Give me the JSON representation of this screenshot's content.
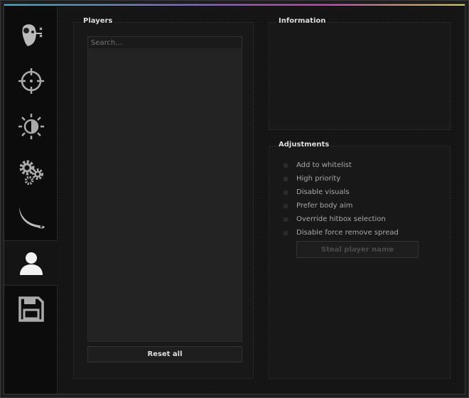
{
  "tabs": [
    {
      "icon": "ragebot-head-icon"
    },
    {
      "icon": "crosshair-icon"
    },
    {
      "icon": "visuals-brightness-icon"
    },
    {
      "icon": "gears-icon"
    },
    {
      "icon": "knife-icon"
    },
    {
      "icon": "user-icon",
      "active": true
    },
    {
      "icon": "save-floppy-icon"
    }
  ],
  "players": {
    "title": "Players",
    "search_placeholder": "Search...",
    "search_value": "",
    "reset_label": "Reset all"
  },
  "information": {
    "title": "Information"
  },
  "adjustments": {
    "title": "Adjustments",
    "options": [
      {
        "label": "Add to whitelist",
        "checked": false
      },
      {
        "label": "High priority",
        "checked": false
      },
      {
        "label": "Disable visuals",
        "checked": false
      },
      {
        "label": "Prefer body aim",
        "checked": false
      },
      {
        "label": "Override hitbox selection",
        "checked": false
      },
      {
        "label": "Disable force remove spread",
        "checked": false
      }
    ],
    "steal_label": "Steal player name"
  },
  "colors": {
    "accent_gradient": [
      "#3bb2d6",
      "#c94fb8",
      "#d4d44a"
    ]
  }
}
